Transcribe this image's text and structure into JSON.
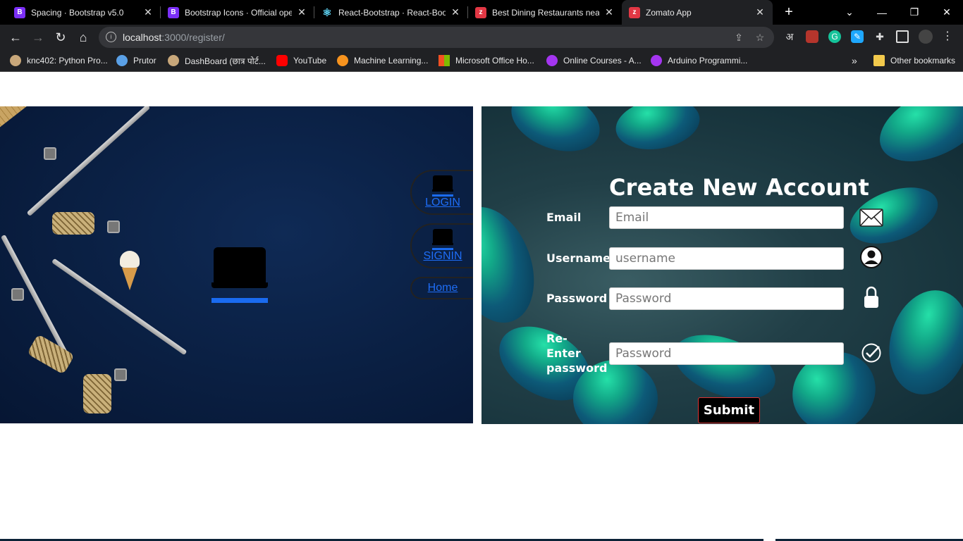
{
  "browser": {
    "tabs": [
      {
        "title": "Spacing · Bootstrap v5.0",
        "fav": "B",
        "color": "#7b2ff7"
      },
      {
        "title": "Bootstrap Icons · Official ope",
        "fav": "B",
        "color": "#7b2ff7"
      },
      {
        "title": "React-Bootstrap · React-Boot",
        "fav": "⚛",
        "color": "#000000"
      },
      {
        "title": "Best Dining Restaurants near",
        "fav": "z",
        "color": "#e23744"
      },
      {
        "title": "Zomato App",
        "fav": "z",
        "color": "#e23744"
      }
    ],
    "url_host": "localhost",
    "url_path": ":3000/register/",
    "bookmarks": [
      {
        "label": "knc402: Python Pro...",
        "color": "#c8a77a"
      },
      {
        "label": "Prutor",
        "color": "#5aa0e6"
      },
      {
        "label": "DashBoard (छात्र पोर्ट...",
        "color": "#c8a77a"
      },
      {
        "label": "YouTube",
        "color": "#ff0000"
      },
      {
        "label": "Machine Learning...",
        "color": "#f7931e"
      },
      {
        "label": "Microsoft Office Ho...",
        "color": "#f25022"
      },
      {
        "label": "Online Courses - A...",
        "color": "#a435f0"
      },
      {
        "label": "Arduino Programmi...",
        "color": "#a435f0"
      }
    ],
    "bookmarks_overflow": "»",
    "other_bookmarks": "Other bookmarks",
    "ext_hindi": "अ"
  },
  "page": {
    "nav": {
      "login": "LOGIN",
      "signin": "SIGNIN",
      "home": "Home"
    },
    "form": {
      "title": "Create New Account",
      "email_label": "Email",
      "email_placeholder": "Email",
      "username_label": "Username",
      "username_placeholder": "username",
      "password_label": "Password",
      "password_placeholder": "Password",
      "reenter_label_1": "Re-",
      "reenter_label_2": "Enter",
      "reenter_label_3": "password",
      "reenter_placeholder": "Password",
      "submit": "Submit"
    }
  }
}
